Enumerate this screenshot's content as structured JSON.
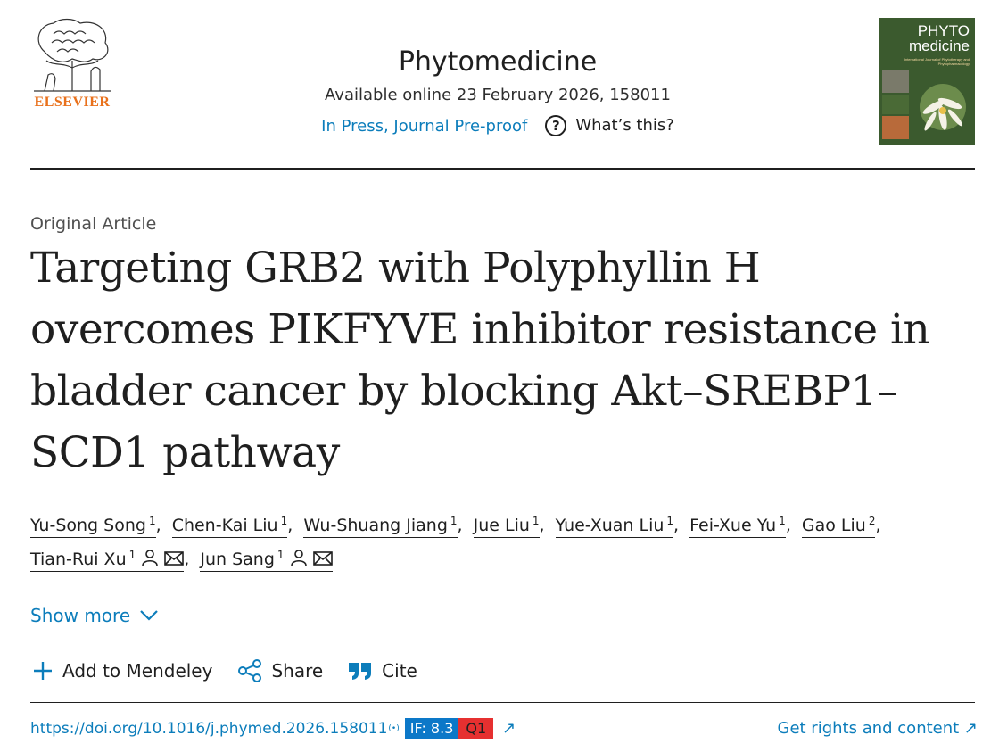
{
  "header": {
    "publisher": "ELSEVIER",
    "journal": "Phytomedicine",
    "available": "Available online 23 February 2026, 158011",
    "status_link": "In Press, Journal Pre-proof",
    "whats_this": "What’s this?",
    "cover": {
      "title_line1": "PHYTO",
      "title_line2": "medicine",
      "subtitle": "International Journal of Phytotherapy and Phytopharmacology"
    }
  },
  "article": {
    "type": "Original Article",
    "title": "Targeting GRB2 with Polyphyllin H overcomes PIKFYVE inhibitor resistance in bladder cancer by blocking Akt–SREBP1–SCD1 pathway",
    "authors": [
      {
        "name": "Yu-Song Song",
        "aff": "1"
      },
      {
        "name": "Chen-Kai Liu",
        "aff": "1"
      },
      {
        "name": "Wu-Shuang Jiang",
        "aff": "1"
      },
      {
        "name": "Jue Liu",
        "aff": "1"
      },
      {
        "name": "Yue-Xuan Liu",
        "aff": "1"
      },
      {
        "name": "Fei-Xue Yu",
        "aff": "1"
      },
      {
        "name": "Gao Liu",
        "aff": "2"
      },
      {
        "name": "Tian-Rui Xu",
        "aff": "1"
      },
      {
        "name": "Jun Sang",
        "aff": "1"
      }
    ],
    "show_more": "Show more"
  },
  "actions": {
    "mendeley": "Add to Mendeley",
    "share": "Share",
    "cite": "Cite"
  },
  "footer": {
    "doi": "https://doi.org/10.1016/j.phymed.2026.158011",
    "impact_factor": "IF: 8.3",
    "quartile": "Q1",
    "rights": "Get rights and content ↗"
  },
  "colors": {
    "link": "#0c7dbb",
    "publisher_orange": "#e9711c",
    "if_badge": "#0c78c8",
    "q_badge": "#e63030"
  }
}
